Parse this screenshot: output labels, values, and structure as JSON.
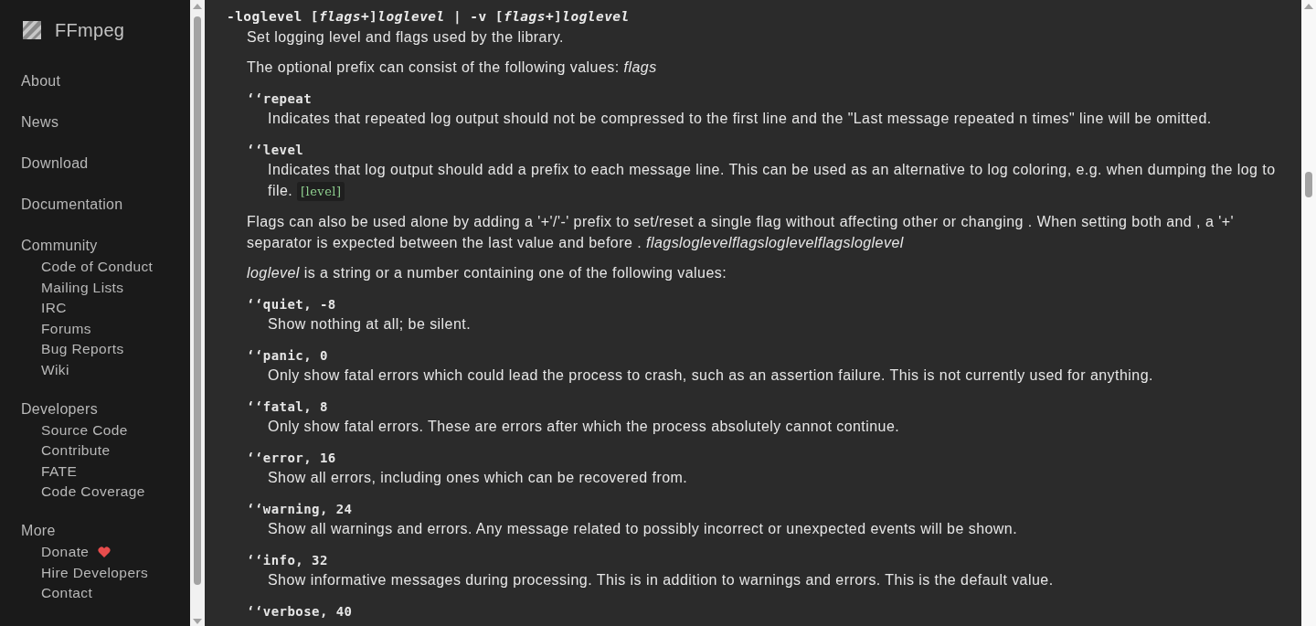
{
  "sidebar": {
    "brand": "FFmpeg",
    "sections": [
      {
        "label": "About"
      },
      {
        "label": "News"
      },
      {
        "label": "Download"
      },
      {
        "label": "Documentation"
      },
      {
        "label": "Community",
        "children": [
          {
            "label": "Code of Conduct",
            "kind": "link"
          },
          {
            "label": "Mailing Lists",
            "kind": "link"
          },
          {
            "label": "IRC",
            "kind": "link"
          },
          {
            "label": "Forums",
            "kind": "link"
          },
          {
            "label": "Bug Reports",
            "kind": "link"
          },
          {
            "label": "Wiki",
            "kind": "link"
          }
        ]
      },
      {
        "label": "Developers",
        "children": [
          {
            "label": "Source Code",
            "kind": "link"
          },
          {
            "label": "Contribute",
            "kind": "link"
          },
          {
            "label": "FATE",
            "kind": "link"
          },
          {
            "label": "Code Coverage",
            "kind": "link"
          }
        ]
      },
      {
        "label": "More",
        "children": [
          {
            "label": "Donate",
            "kind": "heart-link"
          },
          {
            "label": "Hire Developers",
            "kind": "link"
          },
          {
            "label": "Contact",
            "kind": "link"
          }
        ]
      }
    ]
  },
  "content": {
    "heading": "-loglevel [*flags*+]*loglevel* | -v [*flags*+]*loglevel*",
    "intro": "Set logging level and flags used by the library.",
    "blocks": [
      {
        "kind": "paragraph",
        "text": "The optional prefix can consist of the following values: *flags*"
      },
      {
        "kind": "term",
        "term": "‘‘repeat",
        "desc": "Indicates that repeated log output should not be compressed to the first line and the \"Last message repeated n times\" line will be omitted."
      },
      {
        "kind": "term",
        "term": "‘‘level",
        "desc": "Indicates that log output should add a prefix to each message line. This can be used as an alternative to log coloring, e.g. when dumping the log to file.",
        "code": "[level]"
      },
      {
        "kind": "paragraph",
        "text": "Flags can also be used alone by adding a '+'/'-' prefix to set/reset a single flag without affecting other or changing . When setting both and , a '+' separator is expected between the last value and before . *flagsloglevelflagsloglevelflagsloglevel*"
      },
      {
        "kind": "paragraph",
        "text": "*loglevel* is a string or a number containing one of the following values:"
      },
      {
        "kind": "term",
        "term": "‘‘quiet, -8",
        "desc": "Show nothing at all; be silent."
      },
      {
        "kind": "term",
        "term": "‘‘panic, 0",
        "desc": "Only show fatal errors which could lead the process to crash, such as an assertion failure. This is not currently used for anything."
      },
      {
        "kind": "term",
        "term": "‘‘fatal, 8",
        "desc": "Only show fatal errors. These are errors after which the process absolutely cannot continue."
      },
      {
        "kind": "term",
        "term": "‘‘error, 16",
        "desc": "Show all errors, including ones which can be recovered from."
      },
      {
        "kind": "term",
        "term": "‘‘warning, 24",
        "desc": "Show all warnings and errors. Any message related to possibly incorrect or unexpected events will be shown."
      },
      {
        "kind": "term",
        "term": "‘‘info, 32",
        "desc": "Show informative messages during processing. This is in addition to warnings and errors. This is the default value."
      },
      {
        "kind": "term",
        "term": "‘‘verbose, 40"
      }
    ]
  }
}
